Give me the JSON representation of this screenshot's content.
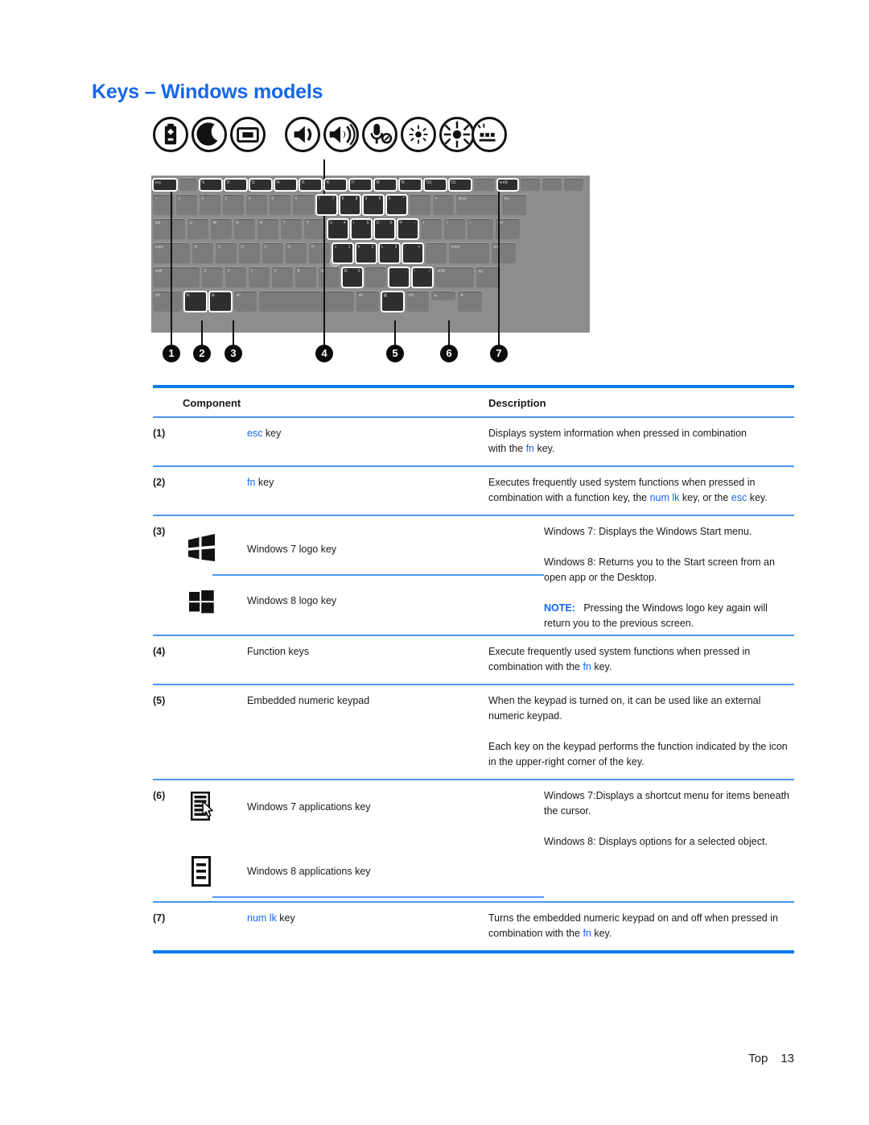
{
  "page": {
    "title": "Keys – Windows models",
    "footer_label": "Top",
    "footer_page": "13"
  },
  "figure": {
    "caption_icons": [
      {
        "name": "battery-icon",
        "label": "battery"
      },
      {
        "name": "sleep-moon-icon",
        "label": "sleep"
      },
      {
        "name": "display-switch-icon",
        "label": "display switch"
      },
      {
        "name": "volume-down-icon",
        "label": "volume down"
      },
      {
        "name": "volume-up-icon",
        "label": "volume up"
      },
      {
        "name": "microphone-mute-icon",
        "label": "microphone mute"
      },
      {
        "name": "screen-dim-icon",
        "label": "screen brightness decrease"
      },
      {
        "name": "screen-brighten-icon",
        "label": "screen brightness increase"
      },
      {
        "name": "keyboard-backlight-icon",
        "label": "keyboard backlight"
      }
    ],
    "callouts": [
      "1",
      "2",
      "3",
      "4",
      "5",
      "6",
      "7"
    ]
  },
  "table": {
    "headers": {
      "component": "Component",
      "description": "Description"
    },
    "rows": [
      {
        "num": "(1)",
        "name_prefix": "esc",
        "name_suffix": " key",
        "desc_1a": "Displays system information when pressed in combination",
        "desc_1b": "with the ",
        "desc_1c": "fn",
        "desc_1d": " key."
      },
      {
        "num": "(2)",
        "name_prefix": "fn",
        "name_suffix": " key",
        "desc_1a": "Executes frequently used system functions when pressed in combination with a function key, the ",
        "desc_1b": "num lk",
        "desc_1c": " key, or the ",
        "desc_1d": "esc",
        "desc_1e": " key."
      },
      {
        "num": "(3)",
        "name_a": "Windows 7 logo key",
        "name_b": "Windows 8 logo key",
        "icon_a": "windows-7-logo-icon",
        "icon_b": "windows-8-logo-icon",
        "desc_1": "Windows 7: Displays the Windows Start menu.",
        "desc_2": "Windows 8: Returns you to the Start screen from an open app or the Desktop.",
        "note_label": "NOTE:",
        "note_text": "Pressing the Windows logo key again will return you to the previous screen."
      },
      {
        "num": "(4)",
        "name": "Function keys",
        "desc_a": "Execute frequently used system functions when pressed in combination with the ",
        "desc_b": "fn",
        "desc_c": " key."
      },
      {
        "num": "(5)",
        "name": "Embedded numeric keypad",
        "desc_1": "When the keypad is turned on, it can be used like an external numeric keypad.",
        "desc_2": "Each key on the keypad performs the function indicated by the icon in the upper-right corner of the key."
      },
      {
        "num": "(6)",
        "name_a": "Windows 7 applications key",
        "name_b": "Windows 8 applications key",
        "icon_a": "windows-7-applications-key-icon",
        "icon_b": "windows-8-applications-key-icon",
        "desc_1": "Windows 7:Displays a shortcut menu for items beneath the cursor.",
        "desc_2": "Windows 8: Displays options for a selected object."
      },
      {
        "num": "(7)",
        "name_prefix": "num lk",
        "name_suffix": " key",
        "desc_a": "Turns the embedded numeric keypad on and off when pressed in combination with the ",
        "desc_b": "fn",
        "desc_c": " key."
      }
    ]
  },
  "colors": {
    "accent_blue": "#1668e8",
    "rule_blue": "#0a7cf0",
    "rule_blue_light": "#4a95f5"
  }
}
